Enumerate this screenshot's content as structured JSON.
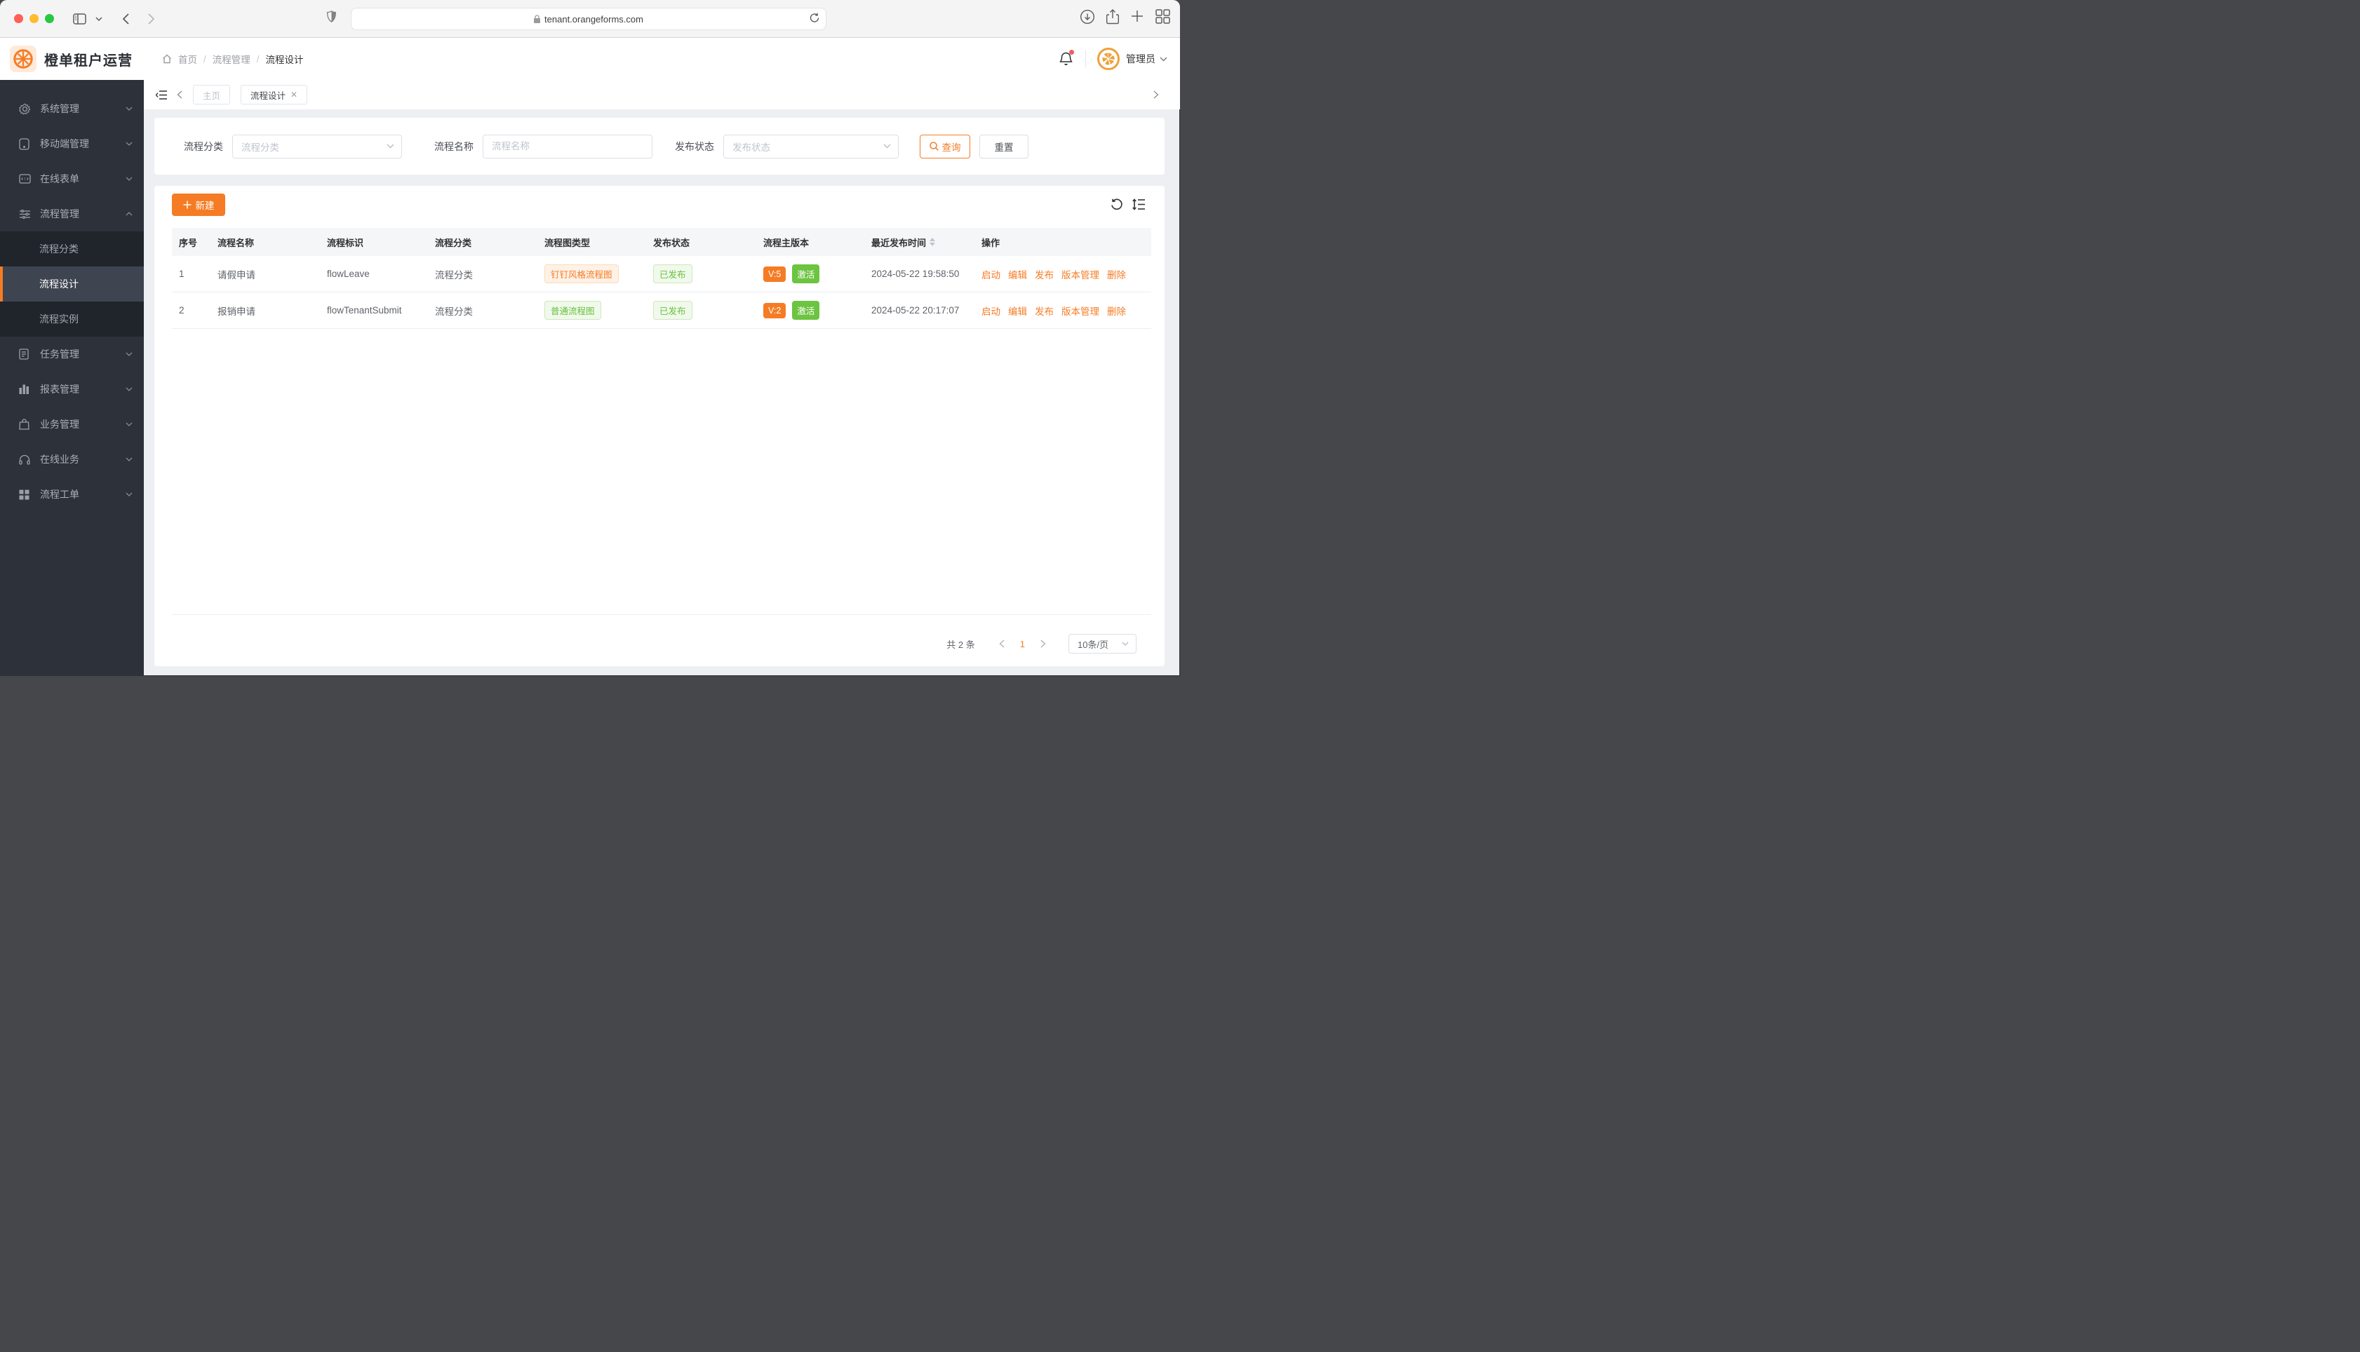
{
  "browser": {
    "url": "tenant.orangeforms.com"
  },
  "app": {
    "title": "橙单租户运营",
    "breadcrumb": {
      "home": "首页",
      "level1": "流程管理",
      "current": "流程设计"
    },
    "user": "管理员"
  },
  "sidebar": {
    "items": [
      {
        "label": "系统管理"
      },
      {
        "label": "移动端管理"
      },
      {
        "label": "在线表单"
      },
      {
        "label": "流程管理"
      },
      {
        "label": "任务管理"
      },
      {
        "label": "报表管理"
      },
      {
        "label": "业务管理"
      },
      {
        "label": "在线业务"
      },
      {
        "label": "流程工单"
      }
    ],
    "flow_children": [
      {
        "label": "流程分类"
      },
      {
        "label": "流程设计"
      },
      {
        "label": "流程实例"
      }
    ]
  },
  "tabs": {
    "home": "主页",
    "active": "流程设计"
  },
  "filters": {
    "category_label": "流程分类",
    "category_placeholder": "流程分类",
    "name_label": "流程名称",
    "name_placeholder": "流程名称",
    "status_label": "发布状态",
    "status_placeholder": "发布状态",
    "query_label": "查询",
    "reset_label": "重置"
  },
  "toolbar": {
    "new_label": "新建"
  },
  "table": {
    "headers": [
      "序号",
      "流程名称",
      "流程标识",
      "流程分类",
      "流程图类型",
      "发布状态",
      "流程主版本",
      "最近发布时间",
      "操作"
    ],
    "rows": [
      {
        "index": "1",
        "name": "请假申请",
        "key": "flowLeave",
        "category": "流程分类",
        "diagram_type": "钉钉风格流程图",
        "publish_status": "已发布",
        "version": "V:5",
        "version_state": "激活",
        "published_at": "2024-05-22 19:58:50"
      },
      {
        "index": "2",
        "name": "报销申请",
        "key": "flowTenantSubmit",
        "category": "流程分类",
        "diagram_type": "普通流程图",
        "publish_status": "已发布",
        "version": "V:2",
        "version_state": "激活",
        "published_at": "2024-05-22 20:17:07"
      }
    ],
    "actions": [
      "启动",
      "编辑",
      "发布",
      "版本管理",
      "删除"
    ]
  },
  "pagination": {
    "total": "共 2 条",
    "page": "1",
    "page_size": "10条/页"
  },
  "colors": {
    "accent": "#f57c24",
    "green": "#6cc441",
    "sidebar_bg": "#2c313a"
  }
}
